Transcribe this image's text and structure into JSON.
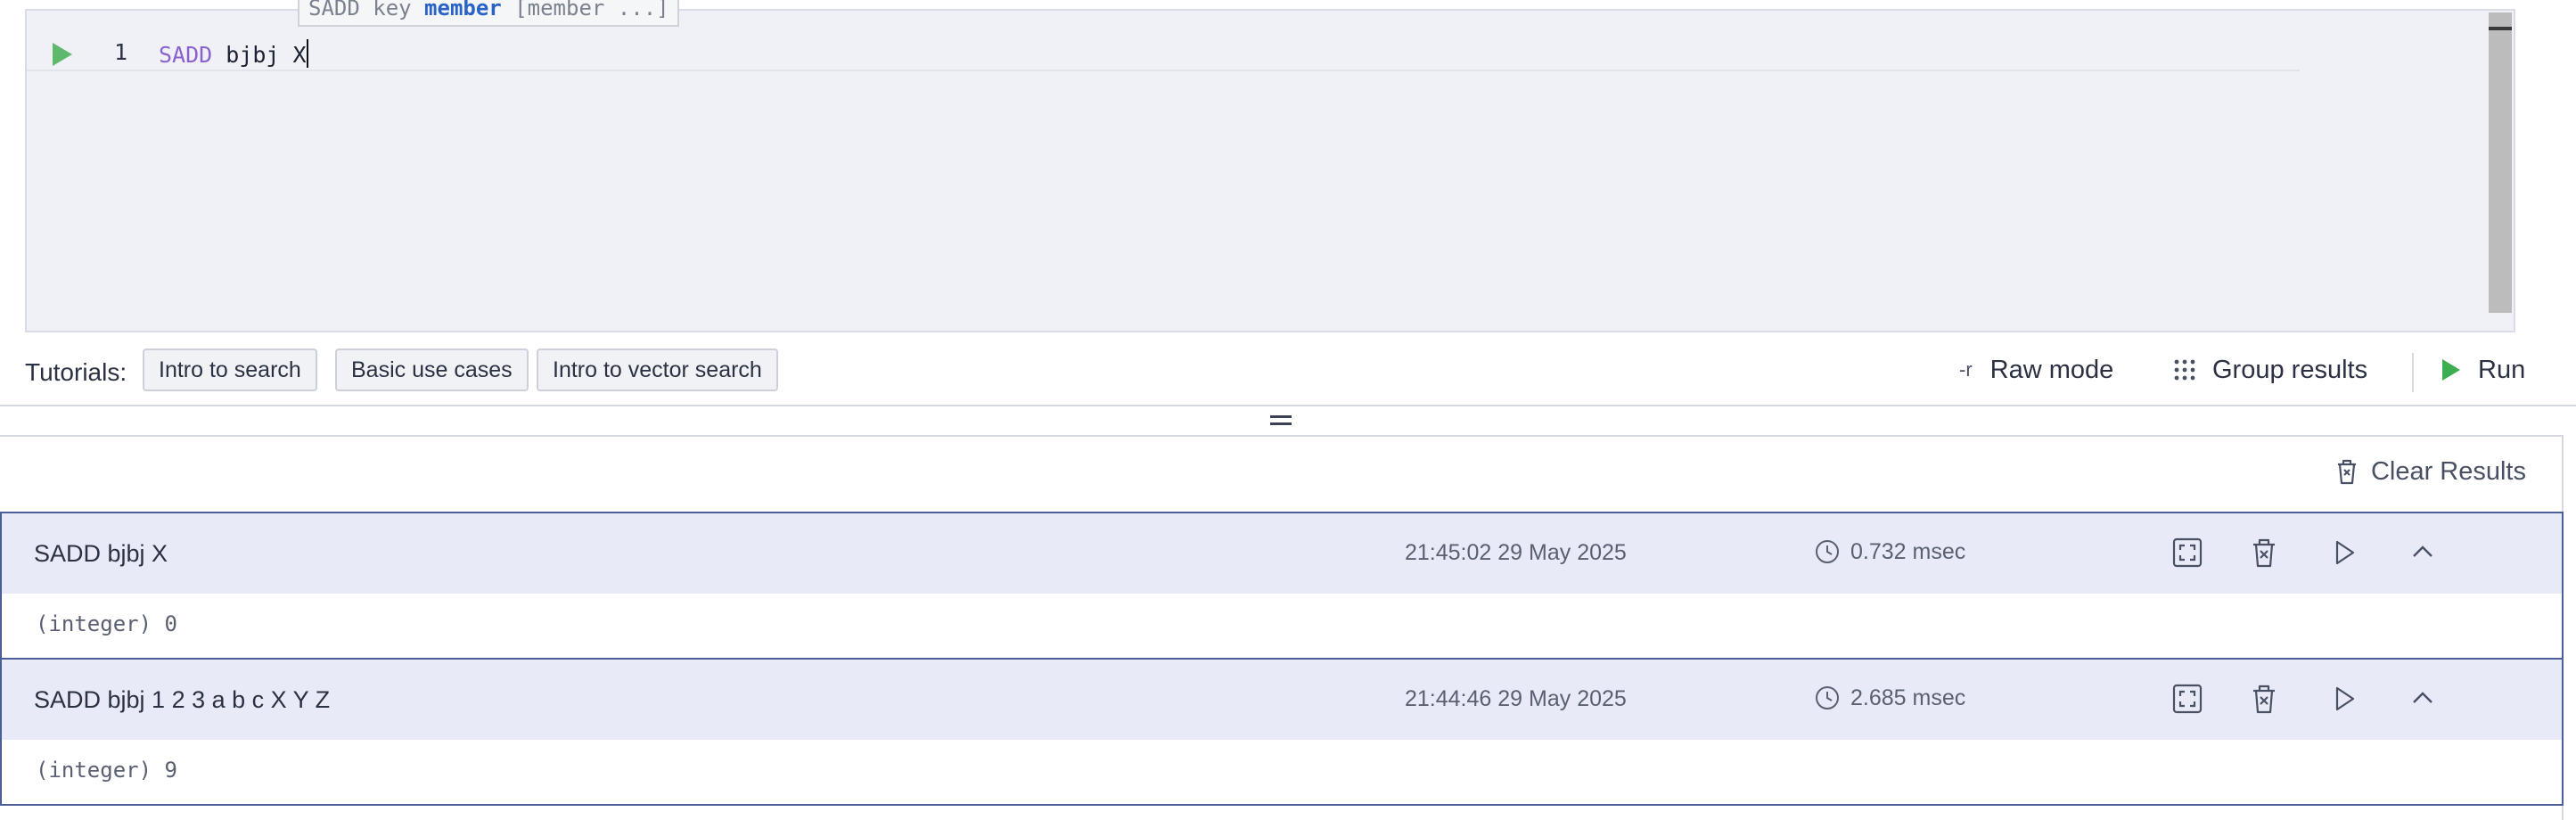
{
  "editor": {
    "line_number": "1",
    "code_keyword": "SADD",
    "code_rest": " bjbj X",
    "hint_prefix": "SADD key ",
    "hint_highlight": "member",
    "hint_suffix": " [member ...]"
  },
  "toolbar": {
    "tutorials_label": "Tutorials:",
    "tutorials": [
      "Intro to search",
      "Basic use cases",
      "Intro to vector search"
    ],
    "raw_mode_icon_text": "-r",
    "raw_mode_label": "Raw mode",
    "group_results_label": "Group results",
    "run_label": "Run"
  },
  "results": {
    "clear_label": "Clear Results",
    "items": [
      {
        "command": "SADD bjbj X",
        "timestamp": "21:45:02 29 May 2025",
        "duration": "0.732 msec",
        "output": "(integer) 0"
      },
      {
        "command": "SADD bjbj 1 2 3 a b c X Y Z",
        "timestamp": "21:44:46 29 May 2025",
        "duration": "2.685 msec",
        "output": "(integer) 9"
      }
    ]
  },
  "colors": {
    "run_green": "#3dae4f",
    "keyword_purple": "#8a62cf",
    "result_header_bg": "#e8ebf7",
    "result_border": "#4a5f9a"
  },
  "icons": {
    "run_line": "play-triangle-icon",
    "group_results": "dots-grid-icon",
    "run": "play-triangle-icon",
    "clear_results": "trash-icon",
    "duration": "clock-icon",
    "fullscreen": "fullscreen-icon",
    "delete": "trash-icon",
    "rerun": "play-outline-icon",
    "collapse": "chevron-up-icon"
  }
}
